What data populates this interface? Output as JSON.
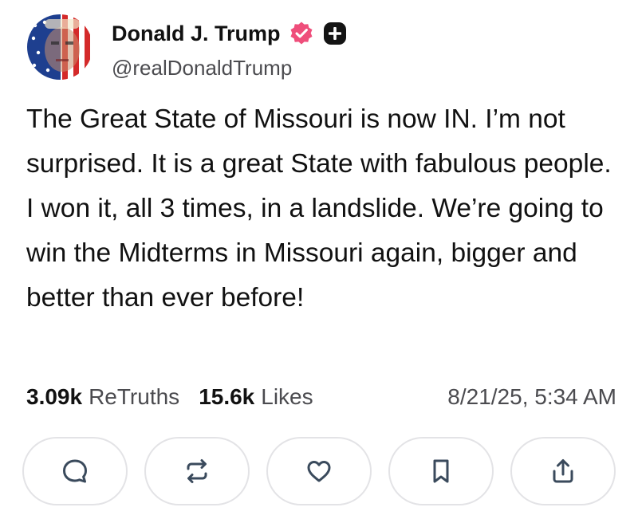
{
  "author": {
    "display_name": "Donald J. Trump",
    "handle": "@realDonaldTrump",
    "avatar_icon": "flag-portrait-avatar",
    "verified_icon": "verified-badge-icon",
    "plus_icon": "plus-badge-icon",
    "accent_color": "#ef4e7b"
  },
  "post": {
    "text": "The Great State of Missouri is now IN. I’m not surprised. It is a great State with fabulous people. I won it, all 3 times, in a landslide. We’re going to win the Midterms in Missouri again, bigger and better than ever before!"
  },
  "stats": {
    "retruths_count": "3.09k",
    "retruths_label": "ReTruths",
    "likes_count": "15.6k",
    "likes_label": "Likes",
    "timestamp": "8/21/25, 5:34 AM"
  },
  "actions": [
    {
      "icon": "reply-icon"
    },
    {
      "icon": "retruth-icon"
    },
    {
      "icon": "like-heart-icon"
    },
    {
      "icon": "bookmark-icon"
    },
    {
      "icon": "share-icon"
    }
  ]
}
